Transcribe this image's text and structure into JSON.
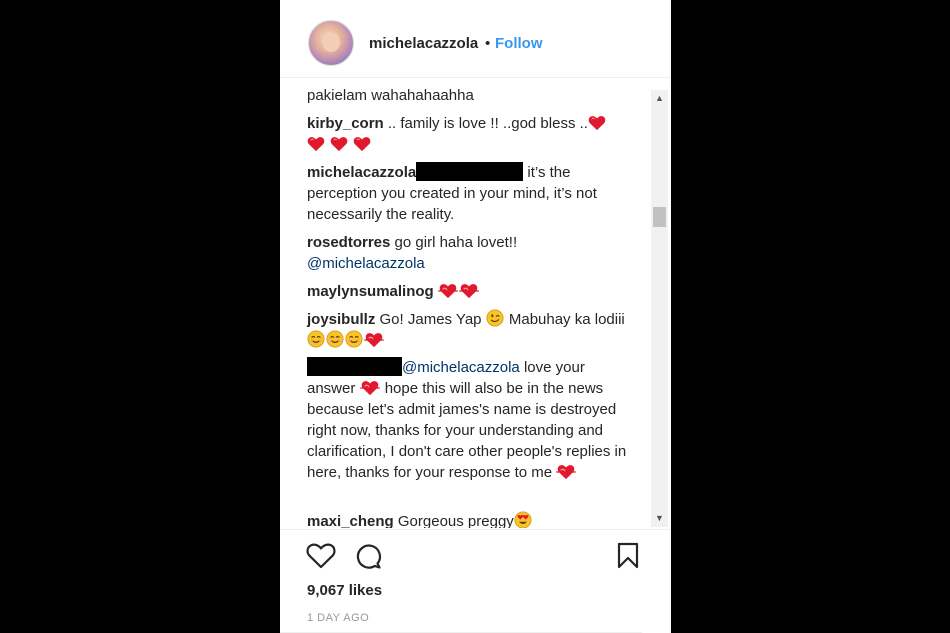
{
  "post": {
    "username": "michelacazzola",
    "separator": "•",
    "follow_label": "Follow",
    "likes": "9,067 likes",
    "timestamp": "1 DAY AGO"
  },
  "comments": [
    {
      "text": "pakielam wahahahaahha"
    },
    {
      "user": "kirby_corn",
      "text": " .. family is love !! ..god bless .."
    },
    {
      "user": "michelacazzola",
      "text": " it’s the perception you created in your mind, it’s not necessarily the reality."
    },
    {
      "user": "rosedtorres",
      "text": " go girl haha lovet!!",
      "mention": "@michelacazzola"
    },
    {
      "user": "maylynsumalinog"
    },
    {
      "user": "joysibullz",
      "text": " Go! James Yap ",
      "text2": " Mabuhay ka lodiii "
    },
    {
      "mention": "@michelacazzola",
      "text": " love your answer ",
      "text2": " hope this will also be in the news because let's admit james's name is destroyed right now, thanks for your understanding and clarification, I don't care other people's replies in here, thanks for your response to me "
    },
    {
      "user": "maxi_cheng",
      "text": " Gorgeous preggy"
    }
  ],
  "icons": {
    "heart_emoji": "red-heart-icon",
    "beating_heart": "beating-heart-icon",
    "wink": "wink-icon",
    "smile": "smiling-face-icon",
    "heart_eyes": "heart-eyes-icon",
    "like": "heart-outline-icon",
    "comment": "comment-bubble-icon",
    "bookmark": "bookmark-icon"
  },
  "colors": {
    "follow": "#3897f0",
    "mention": "#003569",
    "text": "#262626",
    "muted": "#999999",
    "heart": "#e0192e"
  }
}
